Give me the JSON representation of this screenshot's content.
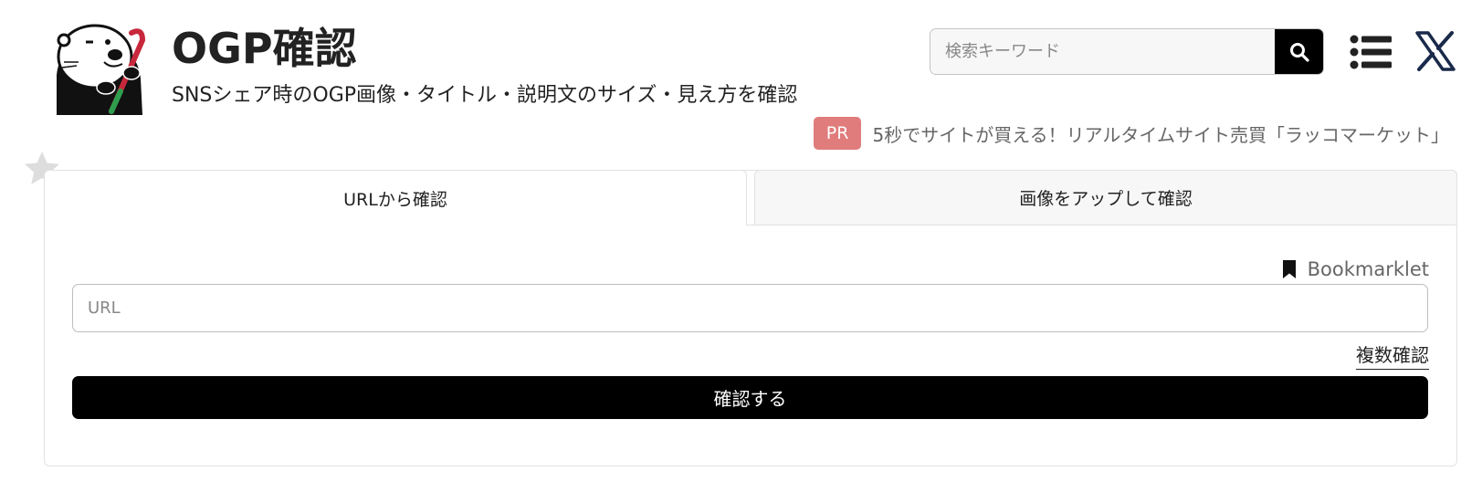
{
  "header": {
    "title": "OGP確認",
    "subtitle": "SNSシェア時のOGP画像・タイトル・説明文のサイズ・見え方を確認",
    "logo_icon": "sea-otter-mascot-icon"
  },
  "search": {
    "placeholder": "検索キーワード",
    "button_icon": "search-icon"
  },
  "nav": {
    "menu_icon": "list-menu-icon",
    "social_icon": "x-logo-icon"
  },
  "ad": {
    "badge": "PR",
    "text": "5秒でサイトが買える！リアルタイムサイト売買「ラッコマーケット」"
  },
  "favorite_icon": "star-icon",
  "tabs": [
    {
      "label": "URLから確認",
      "active": true
    },
    {
      "label": "画像をアップして確認",
      "active": false
    }
  ],
  "form": {
    "bookmarklet_label": "Bookmarklet",
    "url_placeholder": "URL",
    "multi_check_label": "複数確認",
    "submit_label": "確認する"
  },
  "colors": {
    "accent": "#000000",
    "pr_badge": "#e07c7c",
    "tab_inactive_bg": "#f7f7f7",
    "border": "#e2e2e2"
  }
}
